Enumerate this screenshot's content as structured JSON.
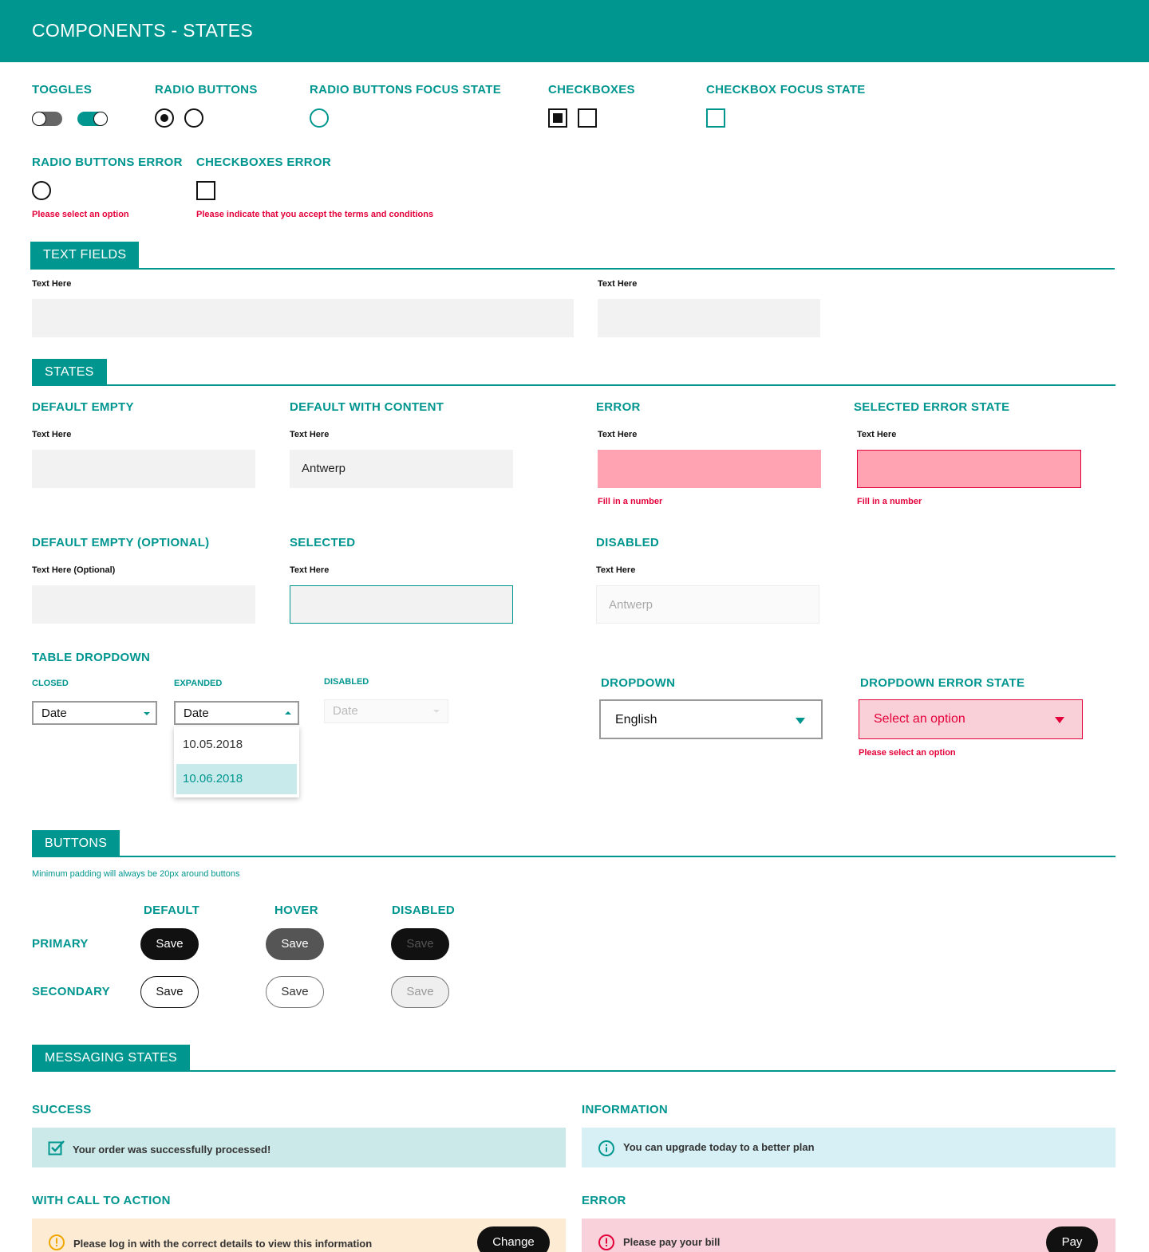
{
  "header": {
    "title": "COMPONENTS - STATES"
  },
  "controls": {
    "toggles": "TOGGLES",
    "radio_buttons": "RADIO BUTTONS",
    "radio_focus": "RADIO BUTTONS FOCUS STATE",
    "checkboxes": "CHECKBOXES",
    "checkbox_focus": "CHECKBOX FOCUS STATE",
    "radio_error": "RADIO BUTTONS ERROR",
    "radio_error_msg": "Please select an option",
    "checkbox_error": "CHECKBOXES ERROR",
    "checkbox_error_msg": "Please indicate that you accept the terms and conditions"
  },
  "text_fields": {
    "section": "TEXT FIELDS",
    "label_1": "Text Here",
    "label_2": "Text Here"
  },
  "states": {
    "section": "STATES",
    "default_empty": {
      "title": "DEFAULT EMPTY",
      "label": "Text Here"
    },
    "default_with_content": {
      "title": "DEFAULT WITH CONTENT",
      "label": "Text Here",
      "value": "Antwerp"
    },
    "error": {
      "title": "ERROR",
      "label": "Text Here",
      "message": "Fill in a number"
    },
    "selected_error": {
      "title": "SELECTED  ERROR STATE",
      "label": "Text Here",
      "message": "Fill in a number"
    },
    "default_empty_optional": {
      "title": "DEFAULT EMPTY (OPTIONAL)",
      "label": "Text Here (Optional)"
    },
    "selected": {
      "title": "SELECTED",
      "label": "Text Here"
    },
    "disabled": {
      "title": "DISABLED",
      "label": "Text Here",
      "value": "Antwerp"
    }
  },
  "table_dropdown": {
    "title": "TABLE DROPDOWN",
    "closed": {
      "label": "CLOSED",
      "value": "Date"
    },
    "expanded": {
      "label": "EXPANDED",
      "value": "Date",
      "options": [
        "10.05.2018",
        "10.06.2018"
      ]
    },
    "disabled": {
      "label": "DISABLED",
      "value": "Date"
    }
  },
  "dropdown": {
    "title": "DROPDOWN",
    "value": "English"
  },
  "dropdown_error": {
    "title": "DROPDOWN  ERROR STATE",
    "value": "Select an option",
    "message": "Please select an option"
  },
  "buttons": {
    "section": "BUTTONS",
    "note": "Minimum padding will always be 20px around buttons",
    "col_default": "DEFAULT",
    "col_hover": "HOVER",
    "col_disabled": "DISABLED",
    "row_primary": "PRIMARY",
    "row_secondary": "SECONDARY",
    "label": "Save"
  },
  "messaging": {
    "section": "MESSAGING STATES",
    "success_title": "SUCCESS",
    "success_text": "Your order was successfully processed!",
    "information_title": "INFORMATION",
    "information_text": "You can upgrade today to a better plan",
    "cta_title": "WITH CALL TO ACTION",
    "cta_text": "Please log in with the correct details to view this information",
    "cta_button": "Change",
    "error_title": "ERROR",
    "error_text": "Please pay your bill",
    "error_button": "Pay"
  },
  "colors": {
    "brand": "#009690",
    "error": "#e4003a",
    "error_fill": "#ffa3b2",
    "success_bg": "#cbe9e8",
    "info_bg": "#d6f0f5",
    "warning_bg": "#fdebd4",
    "error_bg": "#f8d1da"
  }
}
